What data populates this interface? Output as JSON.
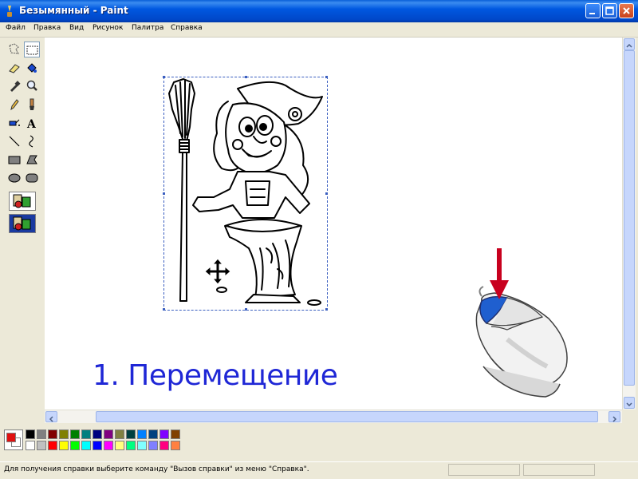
{
  "window": {
    "title": "Безымянный - Paint"
  },
  "menu": [
    "Файл",
    "Правка",
    "Вид",
    "Рисунок",
    "Палитра",
    "Справка"
  ],
  "toolbox": {
    "tools": [
      "free-select",
      "rect-select",
      "eraser",
      "fill",
      "color-picker",
      "magnifier",
      "pencil",
      "brush",
      "airbrush",
      "text",
      "line",
      "curve",
      "rectangle",
      "polygon",
      "ellipse",
      "rounded-rect"
    ],
    "selected": "rect-select",
    "options": [
      "opaque-mode",
      "transparent-mode"
    ],
    "selected_option": "transparent-mode"
  },
  "canvas": {
    "caption": "1. Перемещение",
    "image": "witch-with-broom-illustration",
    "cursor": "move-cursor",
    "mouse_illustration": "mouse-left-button-with-arrow"
  },
  "palette": {
    "foreground": "#000000",
    "background": "#ffffff",
    "row1": [
      "#000000",
      "#808080",
      "#800000",
      "#808000",
      "#008000",
      "#008080",
      "#000080",
      "#800080",
      "#808040",
      "#004040",
      "#0080ff",
      "#004080",
      "#8000ff",
      "#804000"
    ],
    "row2": [
      "#ffffff",
      "#c0c0c0",
      "#ff0000",
      "#ffff00",
      "#00ff00",
      "#00ffff",
      "#0000ff",
      "#ff00ff",
      "#ffff80",
      "#00ff80",
      "#80ffff",
      "#8080ff",
      "#ff0080",
      "#ff8040"
    ]
  },
  "status": {
    "text": "Для получения справки выберите команду \"Вызов справки\" из меню \"Справка\"."
  }
}
